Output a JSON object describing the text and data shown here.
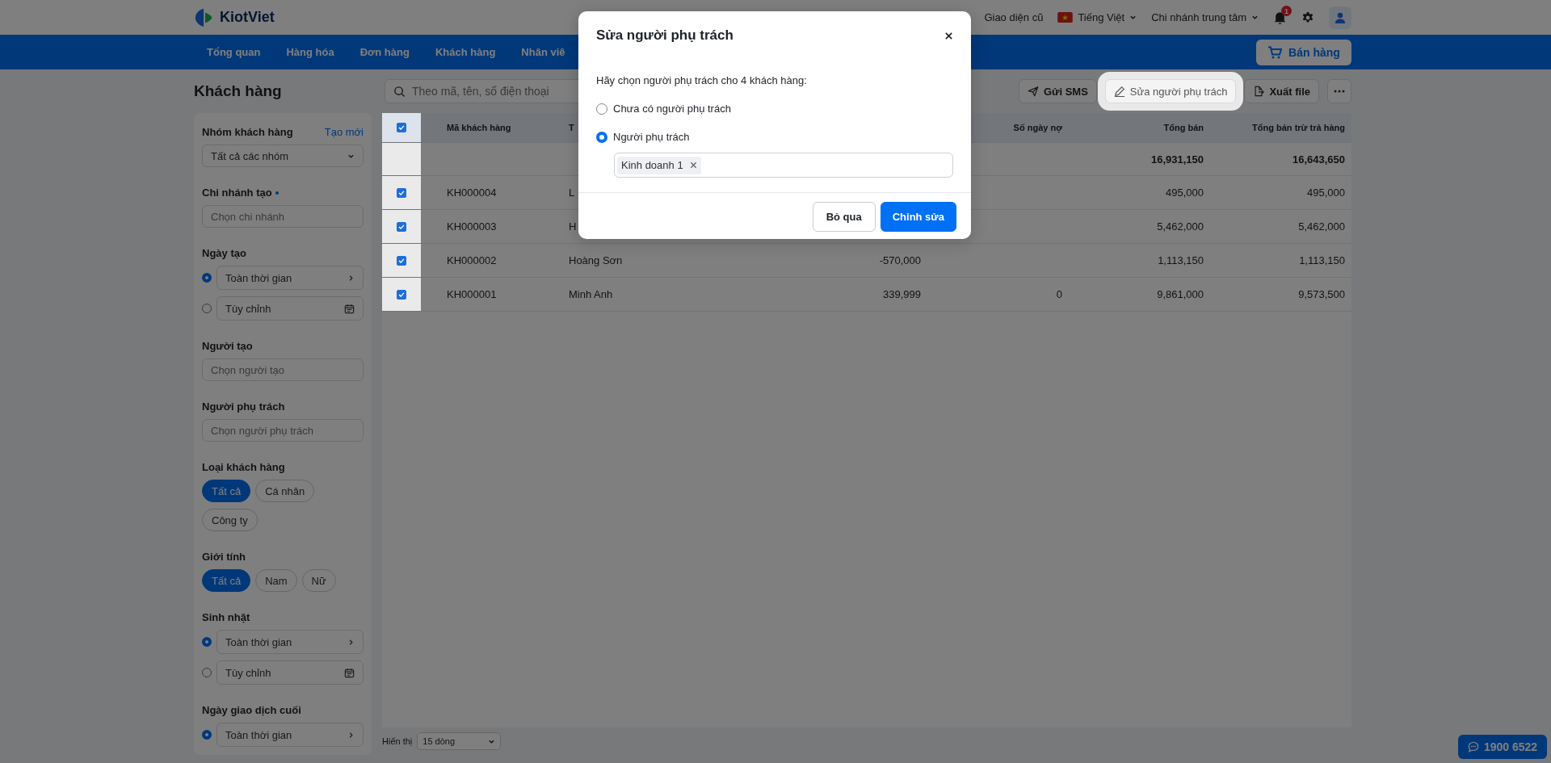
{
  "brand": {
    "name": "KiotViet"
  },
  "topbar": {
    "old_ui": "Giao diện cũ",
    "language": "Tiếng Việt",
    "branch": "Chi nhánh trung tâm",
    "notifications": "1"
  },
  "nav": {
    "items": [
      "Tổng quan",
      "Hàng hóa",
      "Đơn hàng",
      "Khách hàng",
      "Nhân viê"
    ],
    "sell_button": "Bán hàng"
  },
  "page": {
    "title": "Khách hàng",
    "search": {
      "placeholder": "Theo mã, tên, số điện thoại"
    },
    "actions": [
      {
        "label": "Gửi SMS",
        "kind": "sms",
        "highlighted": false
      },
      {
        "label": "Sửa người phụ trách",
        "kind": "edit",
        "highlighted": true
      },
      {
        "label": "Xuất file",
        "kind": "export",
        "highlighted": false
      }
    ]
  },
  "filters": [
    {
      "kind": "select",
      "title": "Nhóm khách hàng",
      "link": "Tạo mới",
      "value": "Tất cả các nhóm"
    },
    {
      "kind": "input",
      "title": "Chi nhánh tạo",
      "required": true,
      "placeholder": "Chọn chi nhánh"
    },
    {
      "kind": "date",
      "title": "Ngày tạo",
      "options": [
        {
          "kind": "preset",
          "label": "Toàn thời gian",
          "selected": true
        },
        {
          "kind": "custom",
          "label": "Tùy chỉnh",
          "selected": false
        }
      ]
    },
    {
      "kind": "input",
      "title": "Người tạo",
      "placeholder": "Chọn người tạo"
    },
    {
      "kind": "input",
      "title": "Người phụ trách",
      "placeholder": "Chọn người phụ trách"
    },
    {
      "kind": "chips",
      "title": "Loại khách hàng",
      "chips": [
        {
          "label": "Tất cả",
          "selected": true
        },
        {
          "label": "Cá nhân",
          "selected": false
        },
        {
          "label": "Công ty",
          "selected": false
        }
      ]
    },
    {
      "kind": "chips",
      "title": "Giới tính",
      "chips": [
        {
          "label": "Tất cả",
          "selected": true
        },
        {
          "label": "Nam",
          "selected": false
        },
        {
          "label": "Nữ",
          "selected": false
        }
      ]
    },
    {
      "kind": "date",
      "title": "Sinh nhật",
      "options": [
        {
          "kind": "preset",
          "label": "Toàn thời gian",
          "selected": true
        },
        {
          "kind": "custom",
          "label": "Tùy chỉnh",
          "selected": false
        }
      ]
    },
    {
      "kind": "date",
      "title": "Ngày giao dịch cuối",
      "options": [
        {
          "kind": "preset",
          "label": "Toàn thời gian",
          "selected": true
        }
      ]
    }
  ],
  "table": {
    "checkbox_column_highlighted": true,
    "select_all": true,
    "header": {
      "code": "Mã khách hàng",
      "name": "T",
      "debt_days": "Số ngày nợ",
      "sales": "Tổng bán",
      "net_sales": "Tổng bán trừ trả hàng"
    },
    "summary": {
      "sales": "16,931,150",
      "net_sales": "16,643,650"
    },
    "rows": [
      {
        "checked": true,
        "code": "KH000004",
        "name": "L",
        "sales": "495,000",
        "net_sales": "495,000"
      },
      {
        "checked": true,
        "code": "KH000003",
        "name": "H",
        "sales": "5,462,000",
        "net_sales": "5,462,000"
      },
      {
        "checked": true,
        "code": "KH000002",
        "name": "Hoàng Sơn",
        "debt": "-570,000",
        "sales": "1,113,150",
        "net_sales": "1,113,150"
      },
      {
        "checked": true,
        "code": "KH000001",
        "name": "Minh Anh",
        "debt": "339,999",
        "debt_days": "0",
        "sales": "9,861,000",
        "net_sales": "9,573,500"
      }
    ]
  },
  "pager": {
    "label": "Hiển thị",
    "page_size": "15 dòng"
  },
  "hotline": "1900 6522",
  "modal": {
    "title": "Sửa người phụ trách",
    "prompt": "Hãy chọn người phụ trách cho 4 khách hàng:",
    "options": [
      {
        "label": "Chưa có người phụ trách",
        "selected": false
      },
      {
        "label": "Người phụ trách",
        "selected": true
      }
    ],
    "tags": [
      "Kinh doanh 1"
    ],
    "buttons": [
      {
        "label": "Bỏ qua",
        "kind": "secondary"
      },
      {
        "label": "Chỉnh sửa",
        "kind": "primary"
      }
    ]
  }
}
